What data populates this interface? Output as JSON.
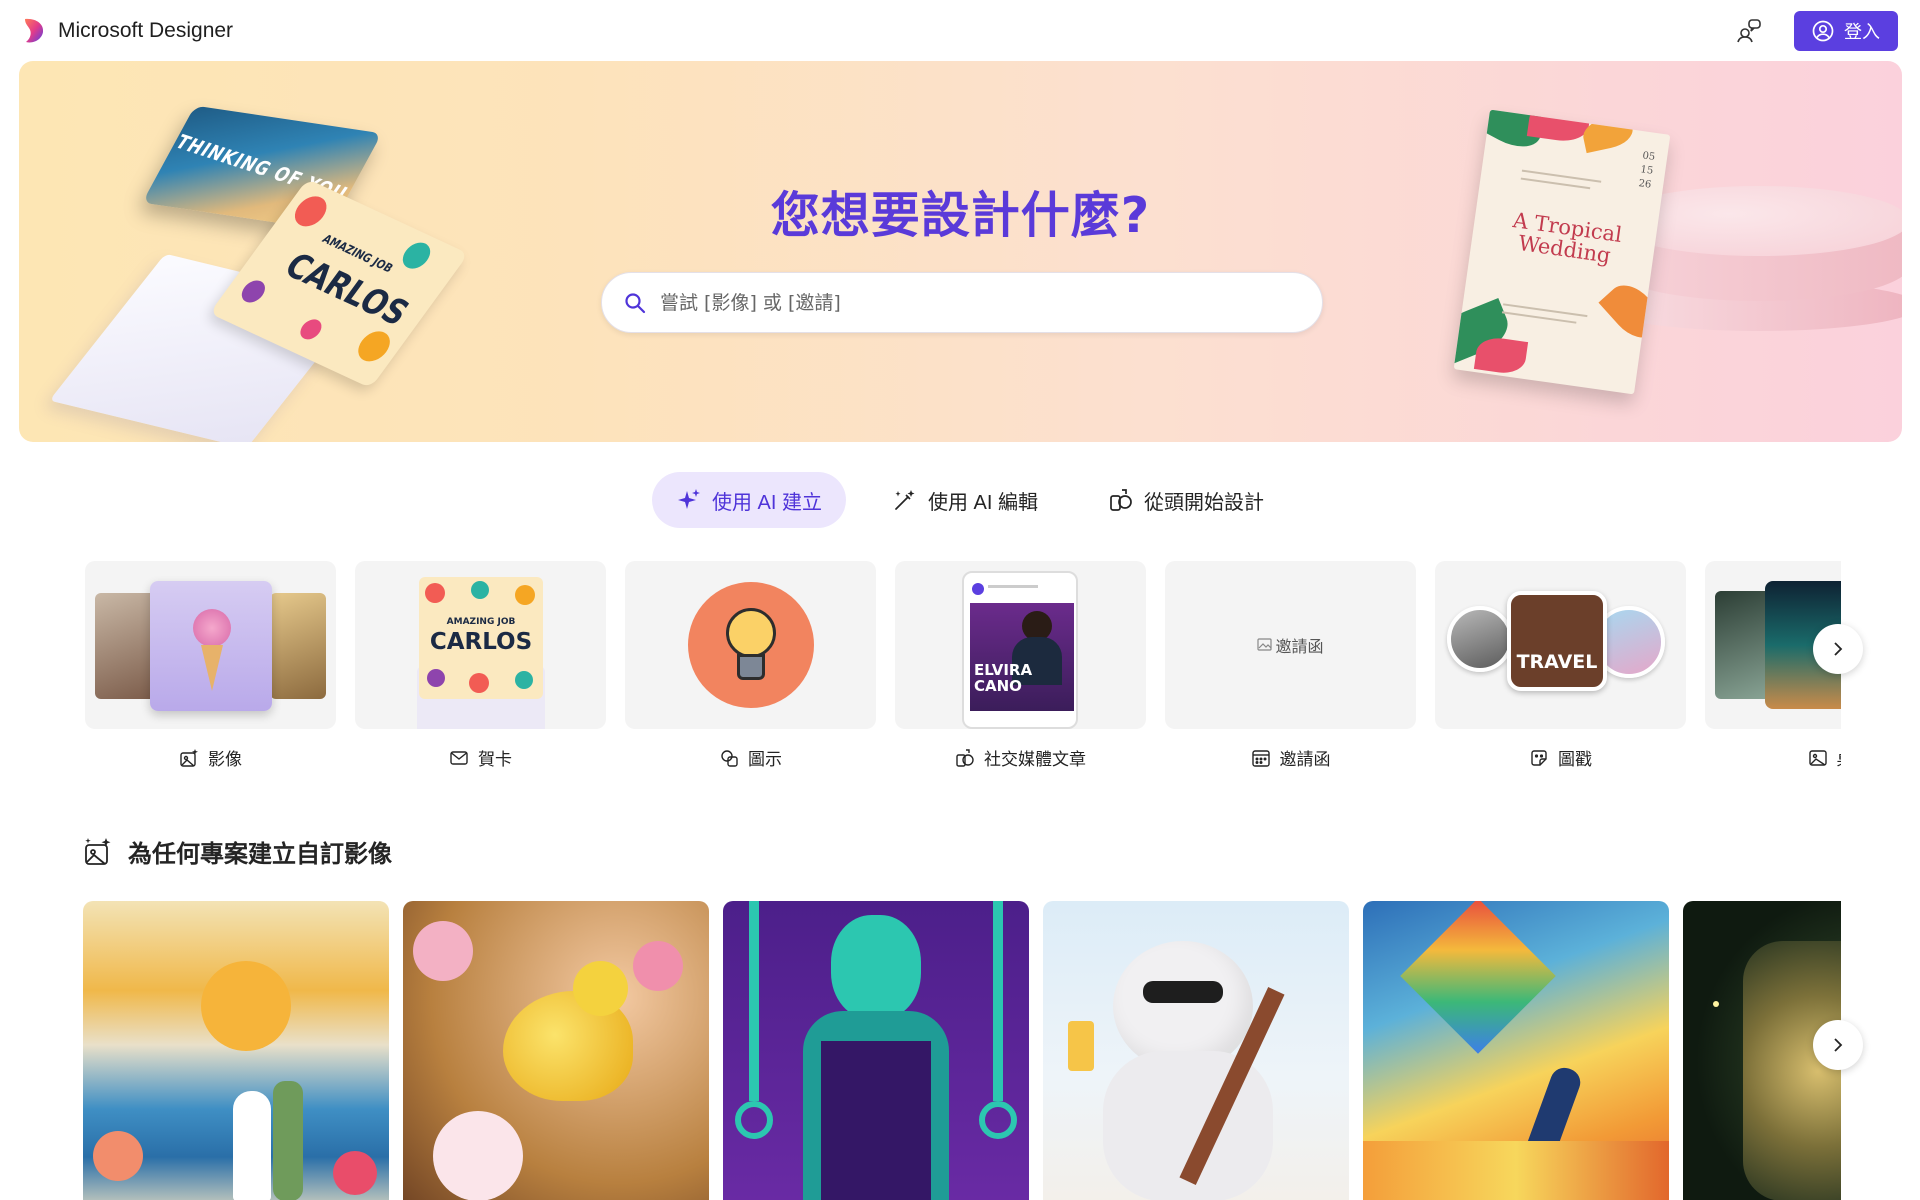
{
  "header": {
    "app_name": "Microsoft Designer",
    "signin_label": "登入"
  },
  "hero": {
    "title": "您想要設計什麼?",
    "search_placeholder": "嘗試 [影像] 或 [邀請]",
    "sky_card_text": "THINKING OF YOU",
    "carlos_card_small": "AMAZING JOB",
    "carlos_card_name": "CARLOS",
    "invite_title": "A Tropical Wedding",
    "invite_date": [
      "05",
      "15",
      "26"
    ]
  },
  "modes": [
    {
      "label": "使用 AI 建立",
      "active": true
    },
    {
      "label": "使用 AI 編輯",
      "active": false
    },
    {
      "label": "從頭開始設計",
      "active": false
    }
  ],
  "categories": [
    {
      "label": "影像",
      "icon": "image-sparkle-icon"
    },
    {
      "label": "賀卡",
      "icon": "mail-icon"
    },
    {
      "label": "圖示",
      "icon": "shapes-icon"
    },
    {
      "label": "社交媒體文章",
      "icon": "social-post-icon"
    },
    {
      "label": "邀請函",
      "icon": "calendar-icon",
      "broken_image_alt": "邀請函"
    },
    {
      "label": "圖戳",
      "icon": "sticker-icon"
    },
    {
      "label": "桌",
      "icon": "image-icon"
    }
  ],
  "category_thumbs": {
    "card_small": "AMAZING JOB",
    "card_name": "CARLOS",
    "social_name": "ELVIRA CANO",
    "sticker_text": "TRAVEL"
  },
  "section": {
    "title": "為任何專案建立自訂影像"
  },
  "colors": {
    "accent": "#5b3fe0",
    "hero_title": "#5a3ad9",
    "active_tab_bg": "#ece6fd"
  }
}
